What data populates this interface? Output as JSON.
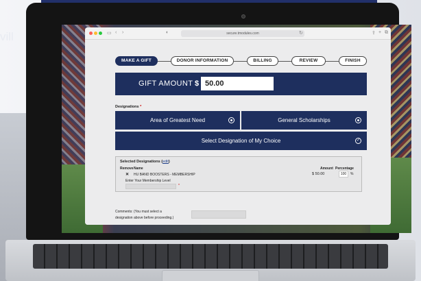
{
  "background": {
    "side_text": "vill"
  },
  "browser": {
    "url": "secure.tmodules.com",
    "icons": [
      "sidebar-icon",
      "back-icon",
      "forward-icon",
      "shield-icon",
      "reload-icon",
      "share-icon",
      "new-tab-icon",
      "tabs-icon"
    ]
  },
  "steps": [
    {
      "label": "MAKE A GIFT",
      "active": true
    },
    {
      "label": "DONOR INFORMATION",
      "active": false
    },
    {
      "label": "BILLING",
      "active": false
    },
    {
      "label": "REVIEW",
      "active": false
    },
    {
      "label": "FINISH",
      "active": false
    }
  ],
  "gift": {
    "label": "GIFT AMOUNT",
    "currency": "$",
    "value": "50.00"
  },
  "designations": {
    "label": "Designations",
    "required_mark": "*",
    "options": [
      {
        "label": "Area of Greatest Need",
        "icon": "radio-icon"
      },
      {
        "label": "General Scholarships",
        "icon": "radio-icon"
      },
      {
        "label": "Select Designation of My Choice",
        "icon": "check-icon"
      }
    ]
  },
  "selected": {
    "title": "Selected Designations (",
    "edit_label": "edit",
    "title_close": ")",
    "col_remove": "Remove",
    "col_name": "Name",
    "col_amount": "Amount",
    "col_percentage": "Percentage",
    "row": {
      "remove": "✕",
      "name": "HU BAND BOOSTERS - MEMBERSHIP",
      "amount": "$ 50.00",
      "percentage": "100",
      "percent_sign": "%"
    },
    "membership_label": "Enter Your Membership Level",
    "membership_required": "*"
  },
  "comments": {
    "line1": "Comments: (You must select a",
    "line2": "designation above before proceeding.)"
  },
  "colors": {
    "navy": "#1e2f5e",
    "page": "#ececed"
  }
}
